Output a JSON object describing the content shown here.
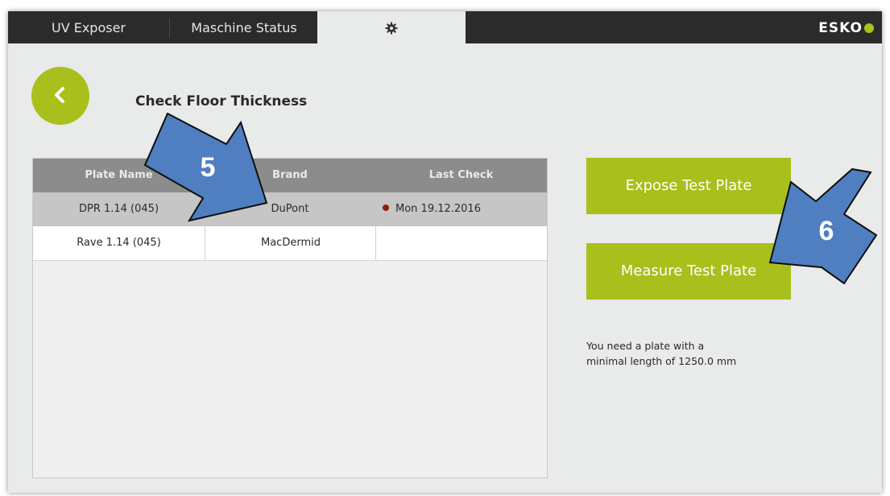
{
  "tabs": [
    {
      "label": "UV Exposer"
    },
    {
      "label": "Maschine Status"
    },
    {
      "icon": "gear-icon"
    }
  ],
  "brand": {
    "logo_text": "ESKO",
    "accent": "#a8bf1c"
  },
  "page": {
    "title": "Check Floor Thickness"
  },
  "table": {
    "headers": [
      "Plate Name",
      "Brand",
      "Last Check"
    ],
    "rows": [
      {
        "plate_name": "DPR 1.14 (045)",
        "brand": "DuPont",
        "last_check": "Mon 19.12.2016",
        "selected": true
      },
      {
        "plate_name": "Rave 1.14 (045)",
        "brand": "MacDermid",
        "last_check": ""
      }
    ]
  },
  "actions": {
    "expose_label": "Expose Test Plate",
    "measure_label": "Measure Test Plate"
  },
  "hint": {
    "line1": "You need a plate with a",
    "line2": "minimal length of 1250.0 mm"
  },
  "annotations": {
    "arrow5_label": "5",
    "arrow6_label": "6",
    "color": "#4f7fc0"
  }
}
